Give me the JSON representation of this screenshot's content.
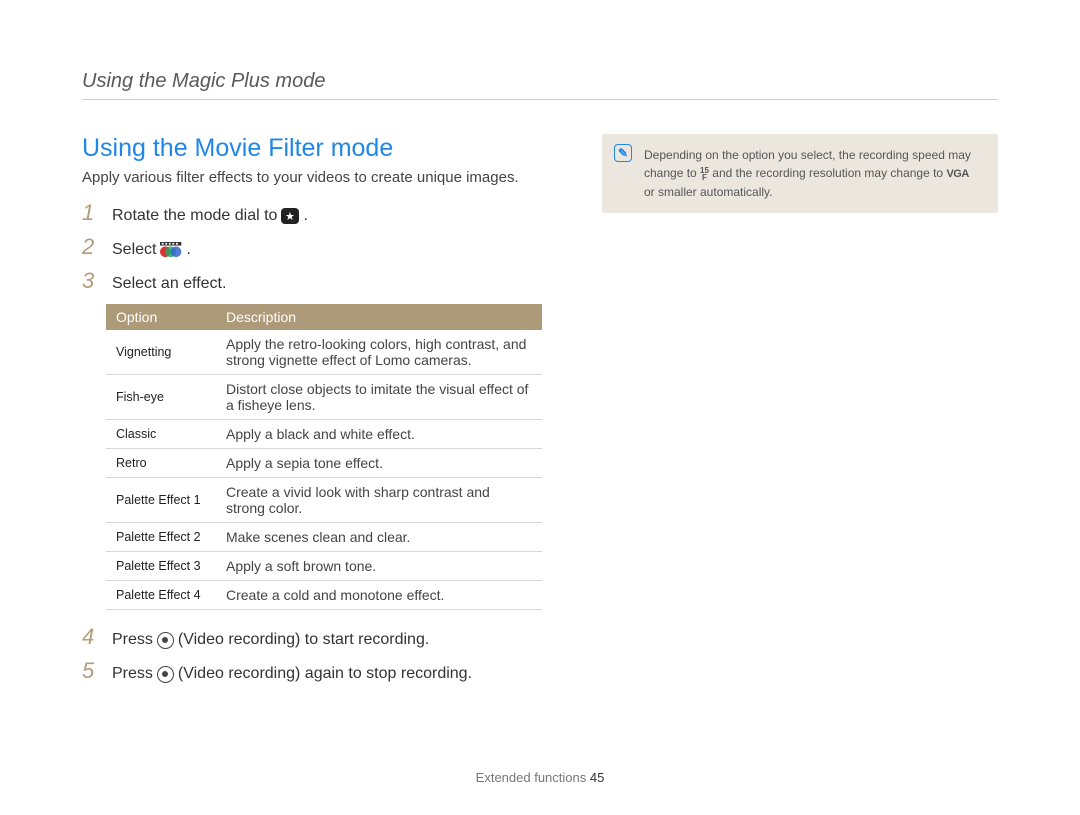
{
  "header": {
    "breadcrumb": "Using the Magic Plus mode"
  },
  "section": {
    "title": "Using the Movie Filter mode",
    "intro": "Apply various filter effects to your videos to create unique images."
  },
  "steps": {
    "s1": {
      "num": "1",
      "pre": "Rotate the mode dial to ",
      "post": "."
    },
    "s2": {
      "num": "2",
      "pre": "Select ",
      "post": "."
    },
    "s3": {
      "num": "3",
      "text": "Select an effect."
    },
    "s4": {
      "num": "4",
      "pre": "Press ",
      "mid": " (Video recording) to start recording."
    },
    "s5": {
      "num": "5",
      "pre": "Press ",
      "mid": " (Video recording) again to stop recording."
    }
  },
  "table": {
    "headers": {
      "option": "Option",
      "description": "Description"
    },
    "rows": [
      {
        "option": "Vignetting",
        "desc": "Apply the retro-looking colors, high contrast, and strong vignette effect of Lomo cameras."
      },
      {
        "option": "Fish-eye",
        "desc": "Distort close objects to imitate the visual effect of a fisheye lens."
      },
      {
        "option": "Classic",
        "desc": "Apply a black and white effect."
      },
      {
        "option": "Retro",
        "desc": "Apply a sepia tone effect."
      },
      {
        "option": "Palette Effect 1",
        "desc": "Create a vivid look with sharp contrast and strong color."
      },
      {
        "option": "Palette Effect 2",
        "desc": "Make scenes clean and clear."
      },
      {
        "option": "Palette Effect 3",
        "desc": "Apply a soft brown tone."
      },
      {
        "option": "Palette Effect 4",
        "desc": "Create a cold and monotone effect."
      }
    ]
  },
  "note": {
    "part1": "Depending on the option you select, the recording speed may change to ",
    "part2": " and the recording resolution may change to ",
    "vga": "VGA",
    "part3": " or smaller automatically."
  },
  "footer": {
    "label": "Extended functions ",
    "page": "45"
  }
}
